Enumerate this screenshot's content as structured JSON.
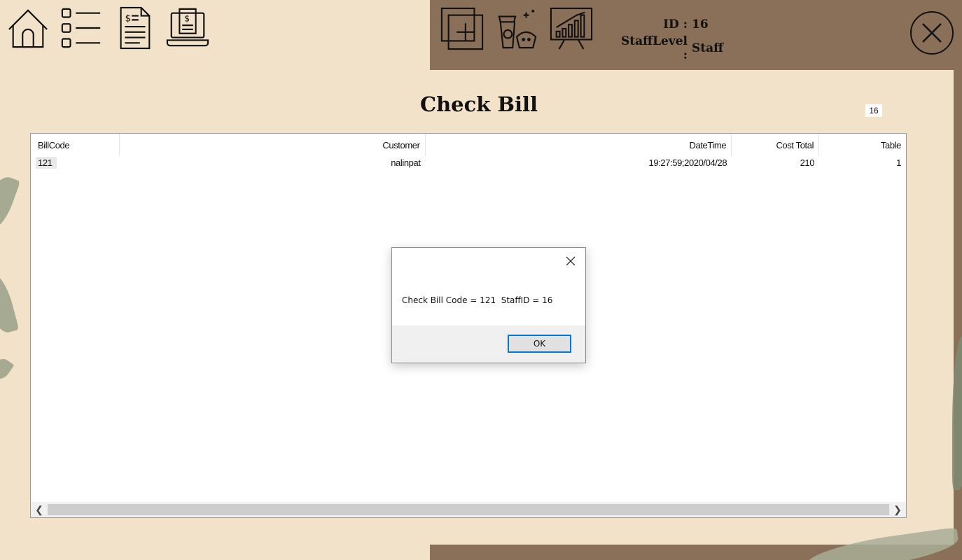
{
  "header": {
    "id_label": "ID :",
    "id_value": "16",
    "staff_level_label": "StaffLevel :",
    "staff_level_value": "Staff"
  },
  "page": {
    "title": "Check Bill",
    "staff_id_box": "16"
  },
  "bill_list": {
    "columns": [
      "BillCode",
      "Customer",
      "DateTime",
      "Cost Total",
      "Table"
    ],
    "rows": [
      [
        "121",
        "nalinpat",
        "19:27:59;2020/04/28",
        "210",
        "1"
      ]
    ]
  },
  "message_box": {
    "text": "Check Bill Code = 121  StaffID = 16",
    "ok_label": "OK"
  },
  "icons": {
    "nav_left": [
      "home-icon",
      "list-icon",
      "invoice-icon",
      "receipt-laptop-icon"
    ],
    "nav_right": [
      "add-icon",
      "food-drink-icon",
      "sales-chart-icon"
    ],
    "close": "close-circle-icon"
  },
  "colors": {
    "background": "#f2e2c9",
    "dark_panel": "#8a7059",
    "accent": "#0078d7"
  }
}
